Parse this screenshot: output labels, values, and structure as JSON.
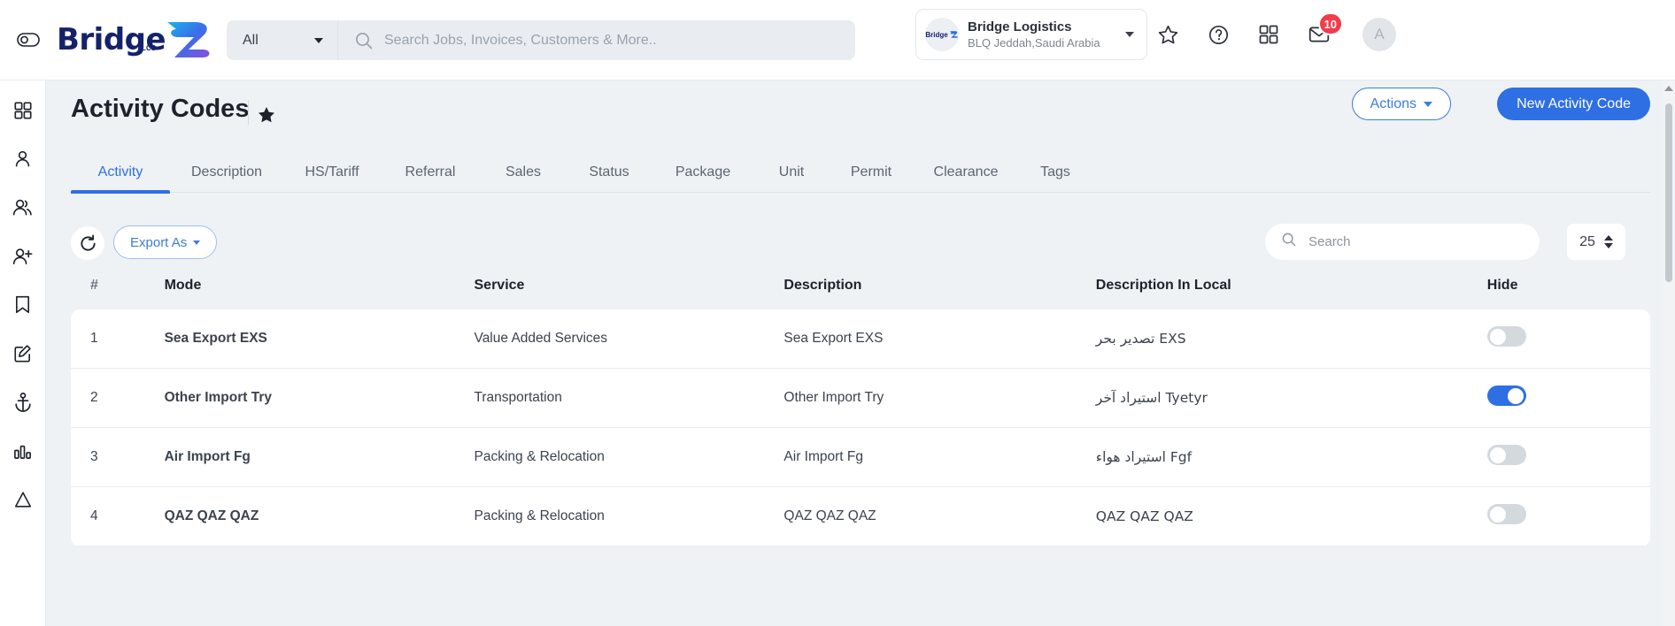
{
  "topbar": {
    "brand_name": "Bridge",
    "brand_sub": "LCS",
    "scope_label": "All",
    "search_placeholder": "Search Jobs, Invoices, Customers & More..",
    "search_value": "",
    "org": {
      "avatar_text": "Bridge",
      "name": "Bridge Logistics",
      "location": "BLQ Jeddah,Saudi Arabia"
    },
    "icons": [
      "star-icon",
      "help-icon",
      "apps-grid-icon",
      "mail-icon"
    ],
    "mail_badge": "10",
    "user_initial": "A"
  },
  "rail": {
    "items": [
      {
        "icon": "dashboard-grid-icon",
        "name": "dashboard"
      },
      {
        "icon": "user-icon",
        "name": "contacts"
      },
      {
        "icon": "users-icon",
        "name": "customers"
      },
      {
        "icon": "user-add-icon",
        "name": "add-user"
      },
      {
        "icon": "bookmark-icon",
        "name": "bookmarks"
      },
      {
        "icon": "edit-square-icon",
        "name": "edit"
      },
      {
        "icon": "anchor-icon",
        "name": "shipping"
      },
      {
        "icon": "bar-chart-icon",
        "name": "reports"
      },
      {
        "icon": "triangle-icon",
        "name": "alerts"
      }
    ]
  },
  "page": {
    "title": "Activity Codes",
    "favorite_icon": "star-filled-icon",
    "actions_label": "Actions",
    "new_label": "New Activity Code"
  },
  "tabs": [
    {
      "label": "Activity",
      "active": true
    },
    {
      "label": "Description",
      "active": false
    },
    {
      "label": "HS/Tariff",
      "active": false
    },
    {
      "label": "Referral",
      "active": false
    },
    {
      "label": "Sales",
      "active": false
    },
    {
      "label": "Status",
      "active": false
    },
    {
      "label": "Package",
      "active": false
    },
    {
      "label": "Unit",
      "active": false
    },
    {
      "label": "Permit",
      "active": false
    },
    {
      "label": "Clearance",
      "active": false
    },
    {
      "label": "Tags",
      "active": false
    }
  ],
  "toolbar": {
    "refresh_icon": "refresh-icon",
    "export_label": "Export As",
    "search_placeholder": "Search",
    "search_value": "",
    "page_size": "25"
  },
  "table": {
    "columns": [
      "#",
      "Mode",
      "Service",
      "Description",
      "Description In Local",
      "Hide"
    ],
    "rows": [
      {
        "index": "1",
        "mode": "Sea Export EXS",
        "service": "Value Added Services",
        "description": "Sea Export EXS",
        "description_local": "تصدير بحر EXS",
        "hide": false
      },
      {
        "index": "2",
        "mode": "Other Import Try",
        "service": "Transportation",
        "description": "Other Import Try",
        "description_local": "استيراد آخر Tyetyr",
        "hide": true
      },
      {
        "index": "3",
        "mode": "Air Import Fg",
        "service": "Packing & Relocation",
        "description": "Air Import Fg",
        "description_local": "استيراد هواء Fgf",
        "hide": false
      },
      {
        "index": "4",
        "mode": "QAZ QAZ QAZ",
        "service": "Packing & Relocation",
        "description": "QAZ QAZ QAZ",
        "description_local": "QAZ QAZ QAZ",
        "hide": false
      }
    ]
  },
  "colors": {
    "accent": "#2f6fe4",
    "link": "#3b7ddd",
    "brand_navy": "#16216b",
    "badge_red": "#f23b4b",
    "page_bg": "#eef2f4"
  }
}
